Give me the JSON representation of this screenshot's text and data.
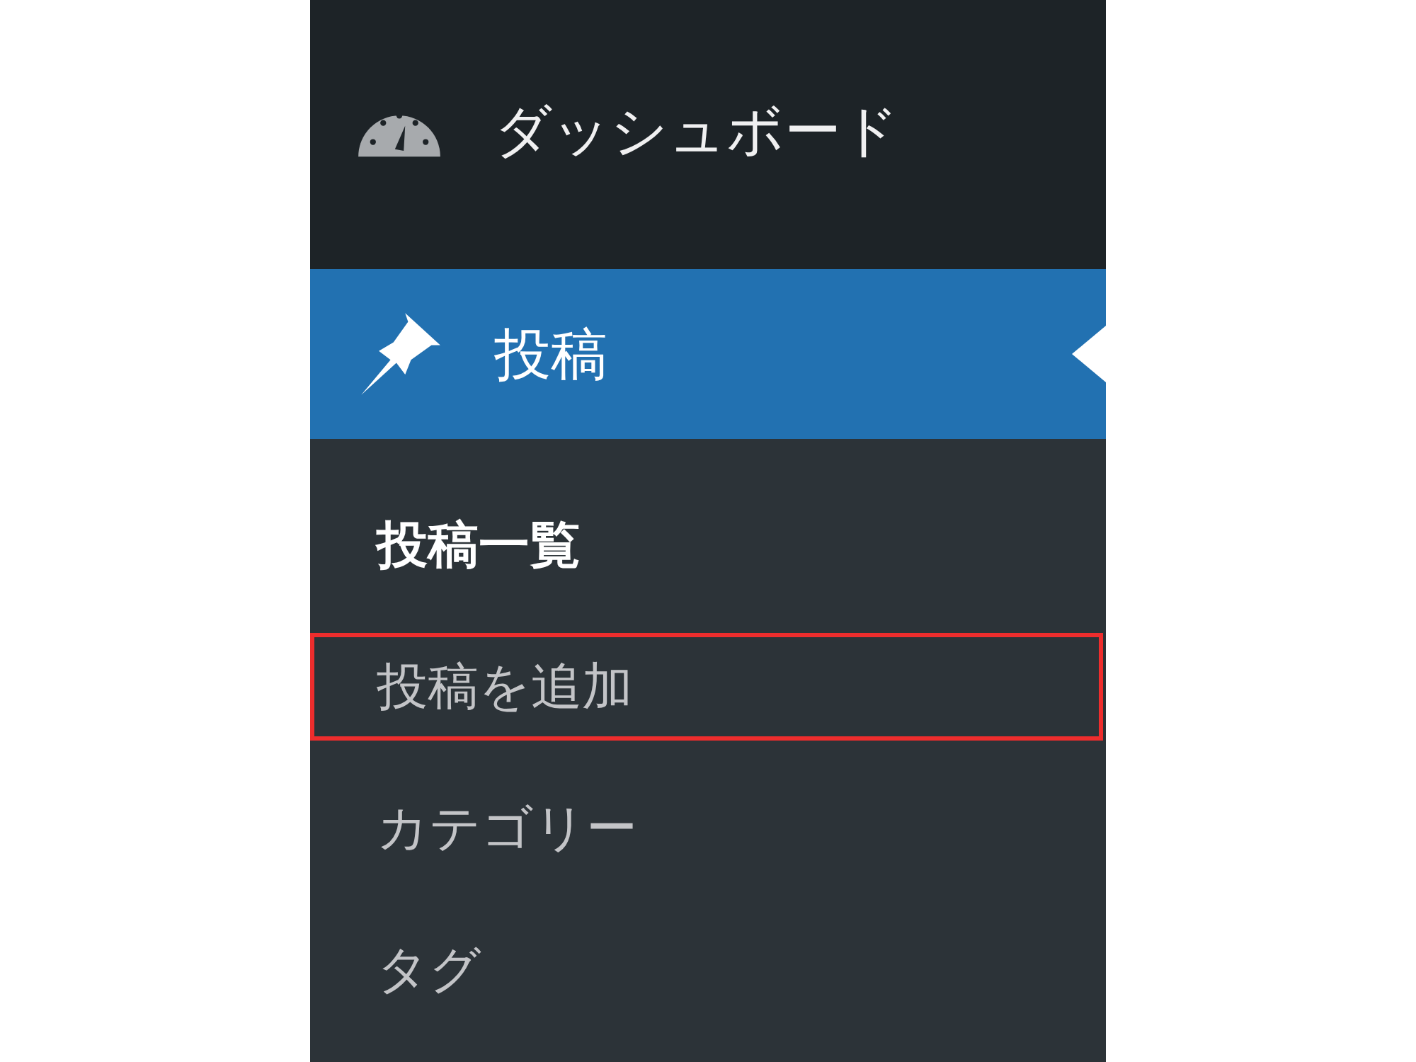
{
  "menu": [
    {
      "label": "ダッシュボード",
      "kind": "dashboard",
      "selected": false
    },
    {
      "label": "投稿",
      "kind": "posts",
      "selected": true
    }
  ],
  "submenu": [
    {
      "label": "投稿一覧",
      "selected": true,
      "highlighted": false
    },
    {
      "label": "投稿を追加",
      "selected": false,
      "highlighted": true
    },
    {
      "label": "カテゴリー",
      "selected": false,
      "highlighted": false
    },
    {
      "label": "タグ",
      "selected": false,
      "highlighted": false
    }
  ]
}
